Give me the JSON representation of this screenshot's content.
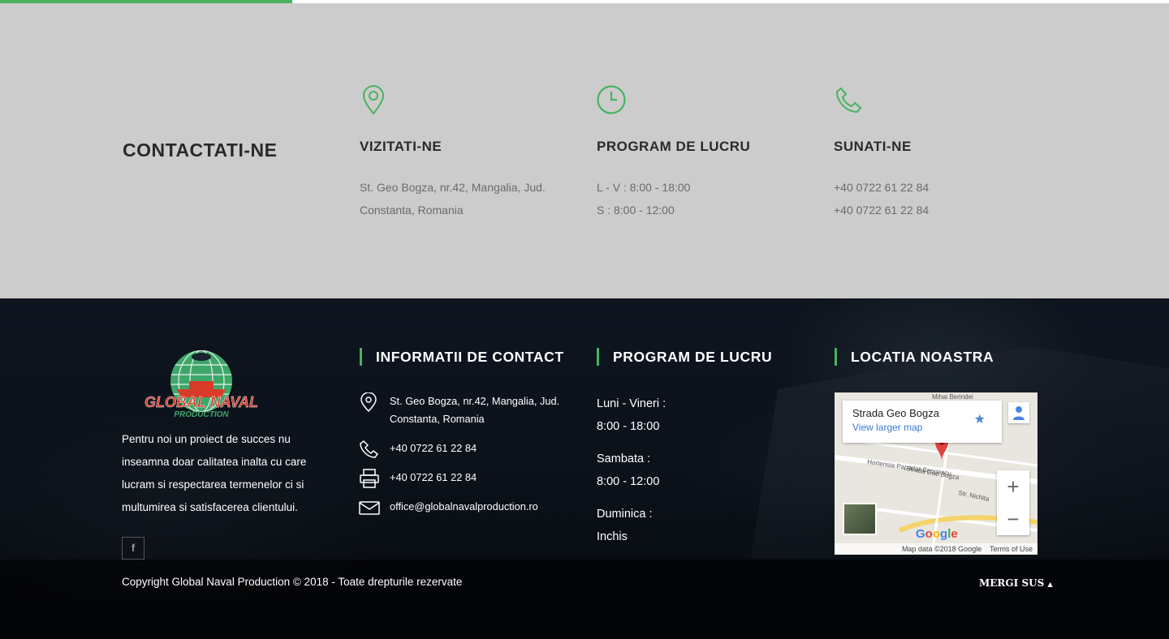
{
  "progress": {
    "value": 0.25,
    "color": "#49b35e"
  },
  "contact": {
    "heading": "CONTACTATI-NE",
    "columns": [
      {
        "icon": "map-pin-icon",
        "title": "VIZITATI-NE",
        "lines": [
          "St. Geo Bogza, nr.42, Mangalia, Jud.",
          "Constanta, Romania"
        ]
      },
      {
        "icon": "clock-icon",
        "title": "PROGRAM DE LUCRU",
        "lines": [
          "L - V : 8:00 - 18:00",
          "S : 8:00 - 12:00"
        ]
      },
      {
        "icon": "phone-icon",
        "title": "SUNATI-NE",
        "lines": [
          "+40 0722 61 22 84",
          "+40 0722 61 22 84"
        ]
      }
    ],
    "accent": "#49b35e"
  },
  "footer": {
    "logo": {
      "name": "GLOBAL NAVAL",
      "sub": "PRODUCTION"
    },
    "about": "Pentru noi un proiect de succes nu inseamna doar calitatea inalta cu care lucram si respectarea termenelor ci si multumirea si satisfacerea clientului.",
    "facebook": "f",
    "info_title": "INFORMATII DE CONTACT",
    "info": {
      "address": "St. Geo Bogza, nr.42, Mangalia, Jud. Constanta, Romania",
      "phone": "+40 0722 61 22 84",
      "fax": "+40 0722 61 22 84",
      "email": "office@globalnavalproduction.ro"
    },
    "hours_title": "PROGRAM DE LUCRU",
    "hours": {
      "weekdays_label": "Luni - Vineri :",
      "weekdays_value": "8:00 - 18:00",
      "saturday_label": "Sambata :",
      "saturday_value": "8:00 - 12:00",
      "sunday_label": "Duminica :",
      "sunday_value": "Inchis"
    },
    "location_title": "LOCATIA NOASTRA",
    "map": {
      "place": "Strada Geo Bogza",
      "link": "View larger map",
      "streets": [
        "Mihai Berindei",
        "Hortensia Papadat-Bengescu",
        "Strada Geo Bogza",
        "Str. Nichita"
      ],
      "zoom_in": "+",
      "zoom_out": "−",
      "brand": "Google",
      "data_credit": "Map data ©2018 Google",
      "terms": "Terms of Use"
    },
    "copyright": "Copyright Global Naval Production © 2018 - Toate drepturile rezervate",
    "to_top": "MERGI SUS"
  }
}
